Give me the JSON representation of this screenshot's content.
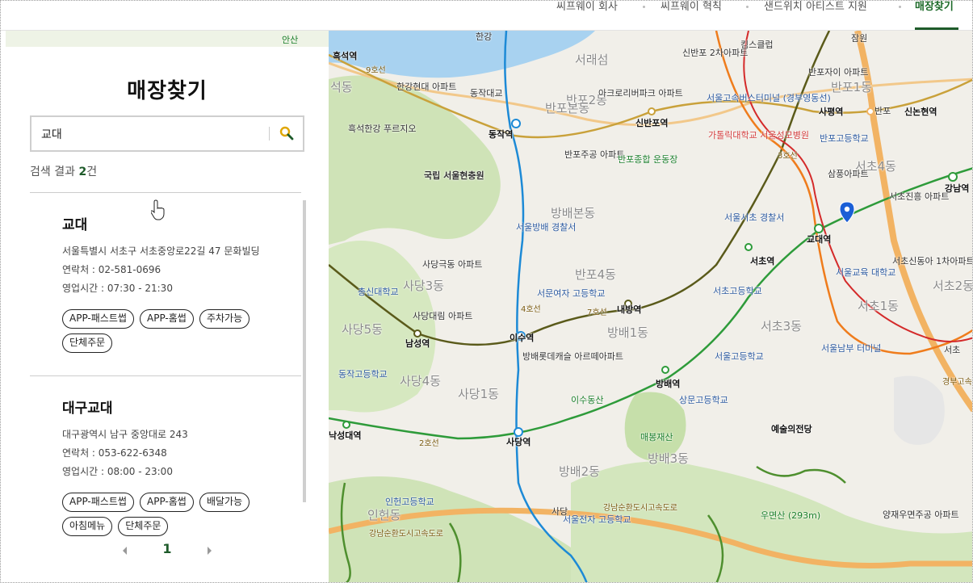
{
  "nav": {
    "items": [
      "씨프웨이 회사",
      "씨프웨이 혁칙",
      "샌드위치 아티스트 지원",
      "매장찾기"
    ]
  },
  "panel": {
    "title": "매장찾기",
    "search_value": "교대",
    "result_prefix": "검색 결과",
    "result_count": "2",
    "result_suffix": "건"
  },
  "stores": [
    {
      "name": "교대",
      "address": "서울특별시 서초구 서초중앙로22길 47 문화빌딩",
      "phone": "연락처 : 02-581-0696",
      "hours": "영업시간 : 07:30 - 21:30",
      "tags": [
        "APP-패스트썹",
        "APP-홈썹",
        "주차가능",
        "단체주문"
      ]
    },
    {
      "name": "대구교대",
      "address": "대구광역시 남구 중앙대로 243",
      "phone": "연락처 : 053-622-6348",
      "hours": "영업시간 : 08:00 - 23:00",
      "tags": [
        "APP-패스트썹",
        "APP-홈썹",
        "배달가능",
        "아침메뉴",
        "단체주문"
      ]
    }
  ],
  "pager": {
    "current": "1"
  },
  "strip_label": "안산",
  "map": {
    "districts": [
      "반포2동",
      "반포본동",
      "반포4동",
      "방배본동",
      "방배4동",
      "방배1동",
      "방배2동",
      "방배3동",
      "서초4동",
      "서초1동",
      "서초3동",
      "사당3동",
      "사당5동",
      "사당4동",
      "사당1동",
      "인헌동",
      "반포1동",
      "서래섬",
      "석동",
      "서초2동"
    ],
    "stations": [
      "동작역",
      "신반포역",
      "사평역",
      "신논현역",
      "강남역",
      "교대역",
      "서초역",
      "내방역",
      "이수역",
      "남성역",
      "방배역",
      "사당역",
      "낙성대역",
      "흑석역"
    ],
    "places": [
      "국립 서울현충원",
      "한강현대 아파트",
      "흑석한강 푸르지오",
      "반포주공 아파트",
      "반포종합 운동장",
      "아크로리버파크 아파트",
      "신반포 2차아파트",
      "킴스클럽",
      "서울고속버스터미널 (경부영동선)",
      "가톨릭대학교 서울성모병원",
      "반포자이 아파트",
      "반포고등학교",
      "삼풍아파트",
      "서초진흥 아파트",
      "서울서초 경찰서",
      "서울방배 경찰서",
      "사당극동 아파트",
      "총신대학교",
      "사당대림 아파트",
      "서문여자 고등학교",
      "방배롯데캐슬 아르떼아파트",
      "서울교육 대학교",
      "서초고등학교",
      "서울고등학교",
      "서초신동아 1차아파트",
      "서울남부 터미널",
      "이수동산",
      "상문고등학교",
      "예술의전당",
      "매봉재산",
      "동작고등학교",
      "인헌고등학교",
      "서울전자 고등학교",
      "우면산 (293m)",
      "양재우면주공 아파트",
      "한강",
      "동작대교",
      "반포",
      "잠원",
      "서초",
      "사당",
      "강남순환도시고속도로",
      "경부고속",
      "9호선",
      "7호선",
      "4호선",
      "2호선",
      "3호선"
    ]
  },
  "colors": {
    "accent": "#1e5b2a",
    "line2": "#2e9b3a",
    "line3": "#ef7c1c",
    "line4": "#1d8ad6",
    "line7": "#5a5a1a",
    "line9": "#c9a13a",
    "shinbundang": "#d42a2a",
    "river": "#a8d2f0",
    "park": "#cfe3b7"
  }
}
